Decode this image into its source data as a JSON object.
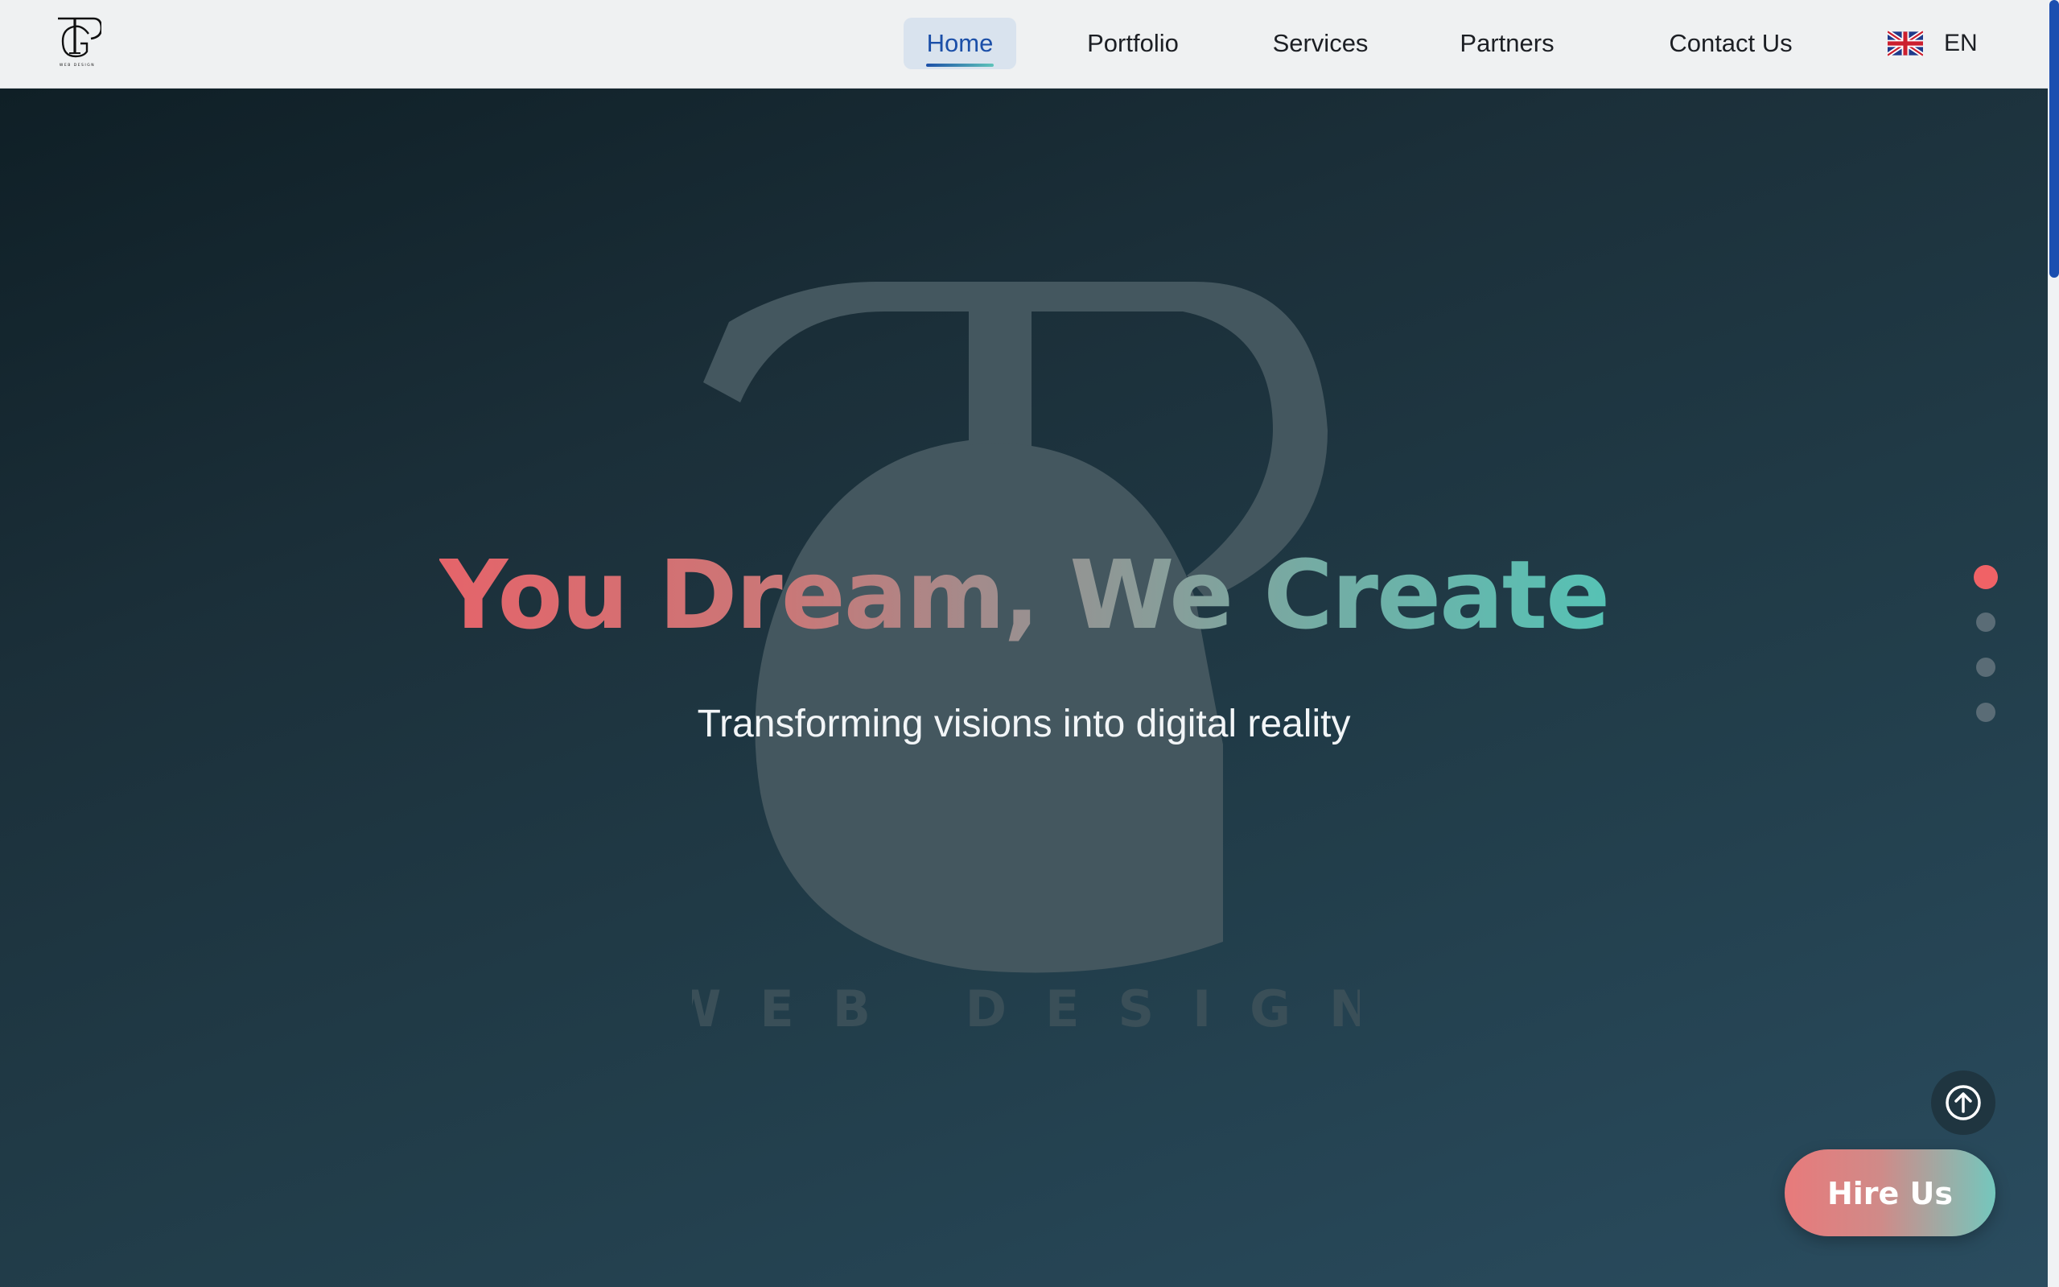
{
  "navbar": {
    "logo_icon": "tg-monogram-logo",
    "items": [
      {
        "label": "Home",
        "active": true
      },
      {
        "label": "Portfolio",
        "active": false
      },
      {
        "label": "Services",
        "active": false
      },
      {
        "label": "Partners",
        "active": false
      },
      {
        "label": "Contact Us",
        "active": false
      }
    ],
    "language": {
      "flag_icon": "uk-flag-icon",
      "code": "EN"
    }
  },
  "hero": {
    "title": "You Dream, We Create",
    "subtitle": "Transforming visions into digital reality",
    "watermark_text": "WEB DESIGN",
    "slide_dots": {
      "count": 4,
      "active_index": 0
    },
    "scroll_top_icon": "arrow-up-circle-icon",
    "cta_label": "Hire Us"
  },
  "colors": {
    "accent_blue": "#1b4fa8",
    "accent_coral": "#f06266",
    "accent_teal": "#56c2b5"
  }
}
